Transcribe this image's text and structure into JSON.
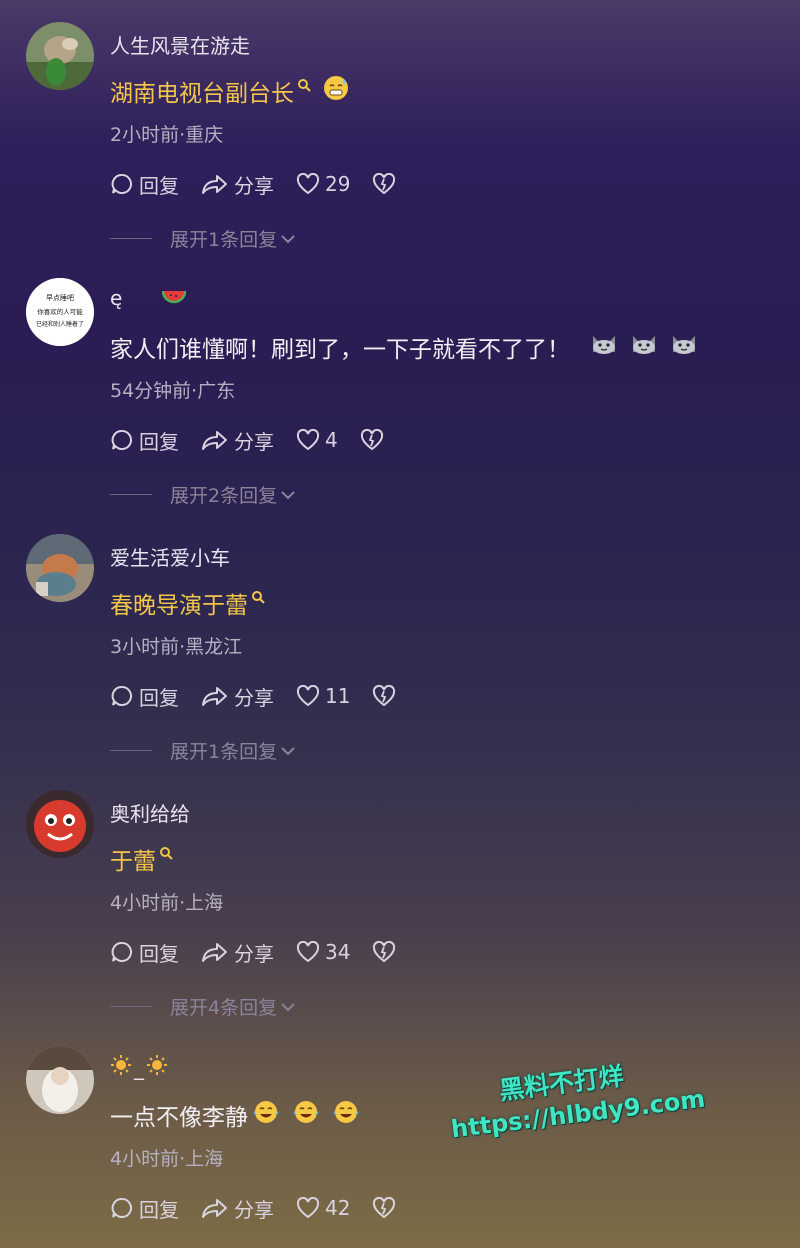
{
  "comments": [
    {
      "username": "人生风景在游走",
      "text": "湖南电视台副台长",
      "text_style": "mention",
      "meta": "2小时前·重庆",
      "reply_label": "回复",
      "share_label": "分享",
      "likes": "29",
      "expand_label": "展开1条回复",
      "emoji_after_text": [
        "sweat-smile-emoji"
      ]
    },
    {
      "username": "ę",
      "username_emoji": "watermelon-emoji",
      "text": "家人们谁懂啊！刷到了，一下子就看不了了！",
      "text_style": "plain",
      "meta": "54分钟前·广东",
      "reply_label": "回复",
      "share_label": "分享",
      "likes": "4",
      "expand_label": "展开2条回复",
      "emoji_after_text": [
        "cat-emoji",
        "cat-emoji",
        "cat-emoji"
      ],
      "avatar_text": [
        "早点睡吧",
        "你喜欢的人可能",
        "已经和别人睡着了"
      ]
    },
    {
      "username": "爱生活爱小车",
      "text": "春晚导演于蕾",
      "text_style": "mention",
      "meta": "3小时前·黑龙江",
      "reply_label": "回复",
      "share_label": "分享",
      "likes": "11",
      "expand_label": "展开1条回复"
    },
    {
      "username": "奥利给给",
      "text": "于蕾",
      "text_style": "mention",
      "meta": "4小时前·上海",
      "reply_label": "回复",
      "share_label": "分享",
      "likes": "34",
      "expand_label": "展开4条回复"
    },
    {
      "username": "_",
      "text": "一点不像李静",
      "text_style": "plain",
      "meta": "4小时前·上海",
      "reply_label": "回复",
      "share_label": "分享",
      "likes": "42",
      "emoji_after_text": [
        "laugh-cry-emoji",
        "laugh-cry-emoji",
        "laugh-cry-emoji"
      ]
    }
  ],
  "watermark": {
    "line1": "黑料不打烊",
    "line2": "https://hlbdy9.com"
  },
  "colors": {
    "mention": "#f3c64a",
    "watermark": "#3ee6c4"
  }
}
